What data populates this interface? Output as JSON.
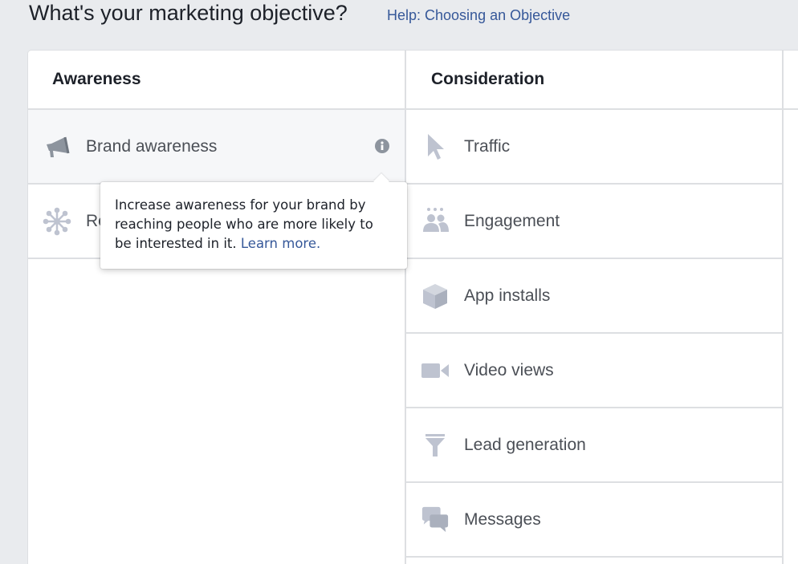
{
  "header": {
    "title": "What's your marketing objective?",
    "help_link": "Help: Choosing an Objective"
  },
  "columns": {
    "awareness": {
      "title": "Awareness",
      "items": [
        {
          "label": "Brand awareness",
          "icon": "megaphone-icon"
        },
        {
          "label": "Reach",
          "icon": "reach-icon"
        }
      ]
    },
    "consideration": {
      "title": "Consideration",
      "items": [
        {
          "label": "Traffic",
          "icon": "cursor-icon"
        },
        {
          "label": "Engagement",
          "icon": "people-icon"
        },
        {
          "label": "App installs",
          "icon": "box-icon"
        },
        {
          "label": "Video views",
          "icon": "video-camera-icon"
        },
        {
          "label": "Lead generation",
          "icon": "funnel-icon"
        },
        {
          "label": "Messages",
          "icon": "chat-bubbles-icon"
        }
      ]
    }
  },
  "tooltip": {
    "text": "Increase awareness for your brand by reaching people who are more likely to be interested in it.",
    "link": "Learn more."
  },
  "colors": {
    "icon": "#bec3d0",
    "icon_active": "#8d949e",
    "link": "#365899",
    "border": "#dddfe2"
  }
}
